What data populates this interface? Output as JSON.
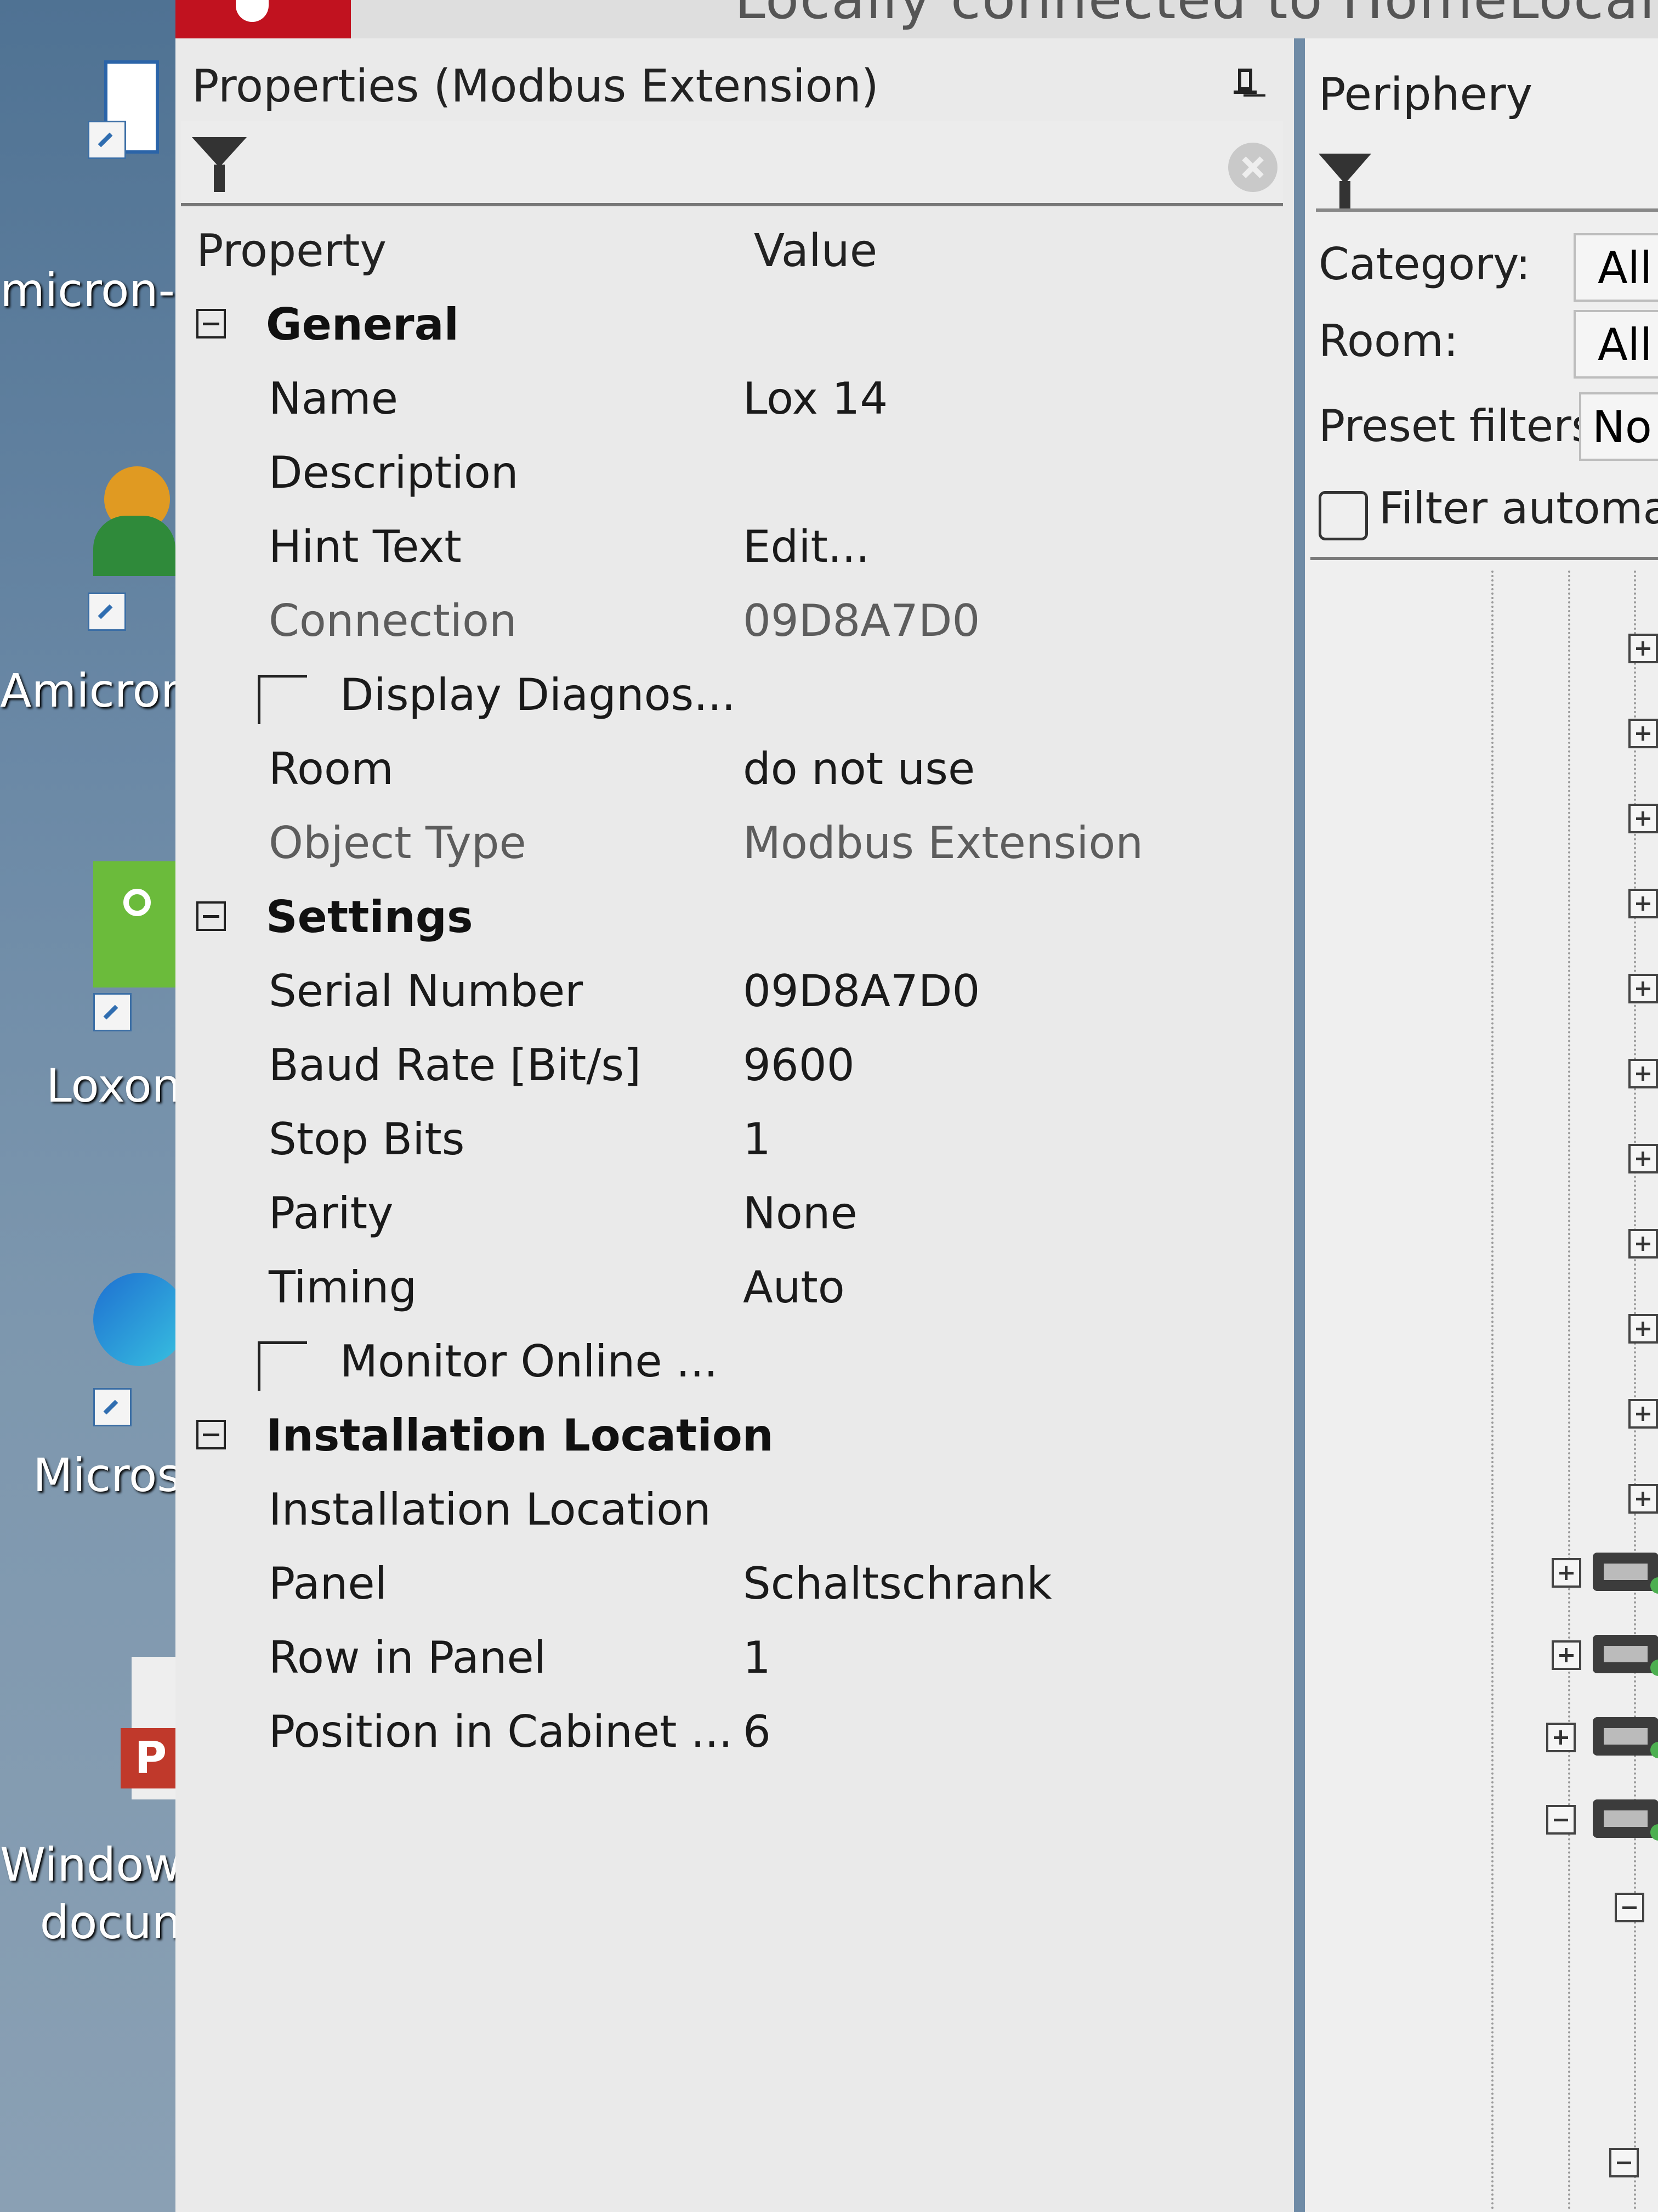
{
  "title_bar": {
    "text": "Locally connected to HomeLocalHome | Mo: Modbu"
  },
  "desktop": {
    "icons": [
      {
        "name": "micron-icon",
        "label": "micron-l"
      },
      {
        "name": "amicron-icon",
        "label": "Amicron-"
      },
      {
        "name": "loxone-icon",
        "label": "Loxon"
      },
      {
        "name": "microsoft-icon",
        "label": "Micros"
      },
      {
        "name": "document-icon",
        "label": "Windows"
      }
    ],
    "extra_label": "docun"
  },
  "properties": {
    "title": "Properties (Modbus Extension)",
    "columns": {
      "property": "Property",
      "value": "Value"
    },
    "categories": [
      {
        "label": "General",
        "rows": [
          {
            "label": "Name",
            "value": "Lox 14"
          },
          {
            "label": "Description",
            "value": ""
          },
          {
            "label": "Hint Text",
            "value": "Edit..."
          },
          {
            "label": "Connection",
            "value": "09D8A7D0"
          },
          {
            "label": "Display Diagnos...",
            "value": ""
          },
          {
            "label": "Room",
            "value": "do not use"
          },
          {
            "label": "Object Type",
            "value": "Modbus Extension"
          }
        ]
      },
      {
        "label": "Settings",
        "rows": [
          {
            "label": "Serial Number",
            "value": "09D8A7D0"
          },
          {
            "label": "Baud Rate [Bit/s]",
            "value": "9600"
          },
          {
            "label": "Stop Bits",
            "value": "1"
          },
          {
            "label": "Parity",
            "value": "None"
          },
          {
            "label": "Timing",
            "value": "Auto"
          },
          {
            "label": "Monitor Online ...",
            "value": ""
          }
        ]
      },
      {
        "label": "Installation Location",
        "rows": [
          {
            "label": "Installation Location",
            "value": ""
          },
          {
            "label": "Panel",
            "value": "Schaltschrank"
          },
          {
            "label": "Row in Panel",
            "value": "1"
          },
          {
            "label": "Position in Cabinet ...",
            "value": "6"
          }
        ]
      }
    ]
  },
  "periphery": {
    "title": "Periphery",
    "category_label": "Category:",
    "category_value": "All",
    "room_label": "Room:",
    "room_value": "All",
    "preset_label": "Preset filters",
    "preset_value": "No",
    "filter_auto_label": "Filter automa"
  },
  "colors": {
    "accent": "#c1121f",
    "panel_bg": "#eaeaea",
    "desktop_bg": "#6b89a6"
  }
}
